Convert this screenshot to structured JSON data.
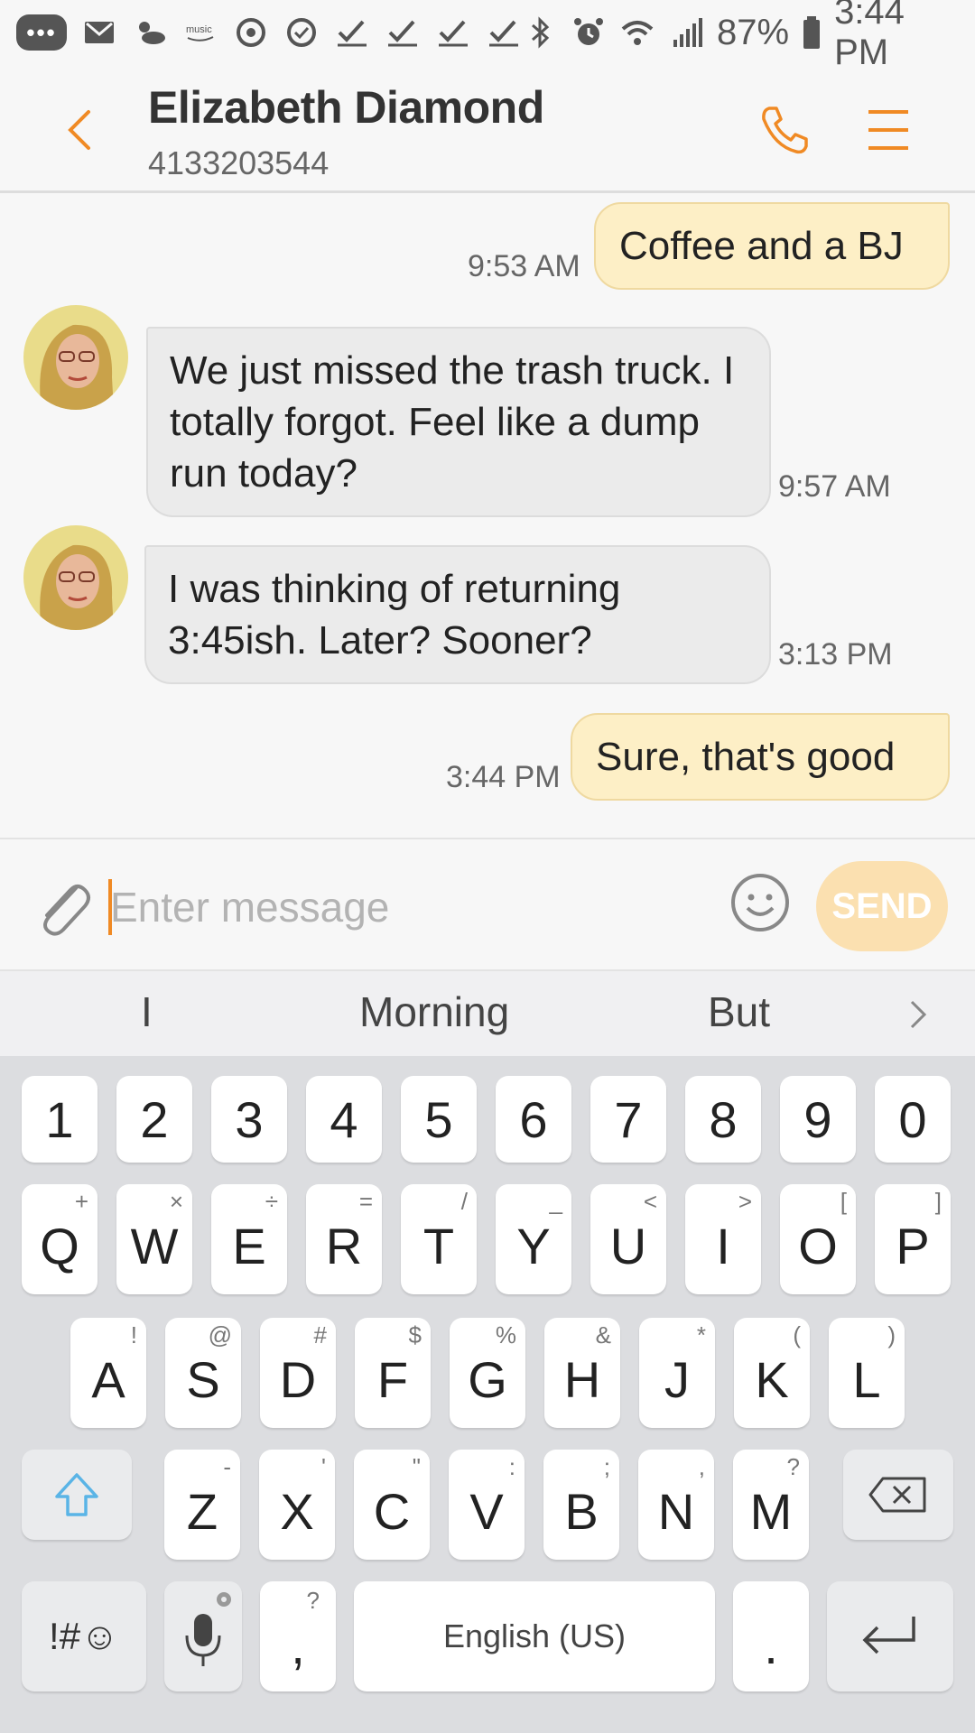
{
  "status_bar": {
    "notification_icons": [
      "messages-icon",
      "gmail-icon",
      "weather-icon",
      "amazon-music-icon",
      "sync-icon",
      "clock-check-icon",
      "check-icon",
      "check-icon",
      "check-icon",
      "check-icon"
    ],
    "battery": "87%",
    "time": "3:44 PM"
  },
  "header": {
    "contact_name": "Elizabeth Diamond",
    "contact_number": "4133203544"
  },
  "messages": [
    {
      "direction": "out",
      "text": "Coffee and a BJ",
      "time": "9:53 AM"
    },
    {
      "direction": "in",
      "text": "We just missed the trash truck. I totally forgot. Feel like a dump run today?",
      "time": "9:57 AM"
    },
    {
      "direction": "in",
      "text": "I was thinking of returning 3:45ish. Later? Sooner?",
      "time": "3:13 PM"
    },
    {
      "direction": "out",
      "text": "Sure, that's good",
      "time": "3:44 PM"
    }
  ],
  "composer": {
    "placeholder": "Enter message",
    "send_label": "SEND"
  },
  "suggestions": [
    "I",
    "Morning",
    "But"
  ],
  "keyboard": {
    "number_row": [
      "1",
      "2",
      "3",
      "4",
      "5",
      "6",
      "7",
      "8",
      "9",
      "0"
    ],
    "row1": [
      {
        "key": "Q",
        "sub": "+"
      },
      {
        "key": "W",
        "sub": "×"
      },
      {
        "key": "E",
        "sub": "÷"
      },
      {
        "key": "R",
        "sub": "="
      },
      {
        "key": "T",
        "sub": "/"
      },
      {
        "key": "Y",
        "sub": "_"
      },
      {
        "key": "U",
        "sub": "<"
      },
      {
        "key": "I",
        "sub": ">"
      },
      {
        "key": "O",
        "sub": "["
      },
      {
        "key": "P",
        "sub": "]"
      }
    ],
    "row2": [
      {
        "key": "A",
        "sub": "!"
      },
      {
        "key": "S",
        "sub": "@"
      },
      {
        "key": "D",
        "sub": "#"
      },
      {
        "key": "F",
        "sub": "$"
      },
      {
        "key": "G",
        "sub": "%"
      },
      {
        "key": "H",
        "sub": "&"
      },
      {
        "key": "J",
        "sub": "*"
      },
      {
        "key": "K",
        "sub": "("
      },
      {
        "key": "L",
        "sub": ")"
      }
    ],
    "row3": [
      {
        "key": "Z",
        "sub": "-"
      },
      {
        "key": "X",
        "sub": "'"
      },
      {
        "key": "C",
        "sub": "\""
      },
      {
        "key": "V",
        "sub": ":"
      },
      {
        "key": "B",
        "sub": ";"
      },
      {
        "key": "N",
        "sub": ","
      },
      {
        "key": "M",
        "sub": "?"
      }
    ],
    "symbols_label": "!#☺",
    "comma_label": ",",
    "comma_sub": "?",
    "space_label": "English (US)",
    "period_label": "."
  },
  "colors": {
    "accent": "#f08a24",
    "outgoing_bubble": "#fdefc6",
    "incoming_bubble": "#ebebeb",
    "send_button": "#fbe0b0",
    "shift_icon": "#5ab4e6"
  }
}
